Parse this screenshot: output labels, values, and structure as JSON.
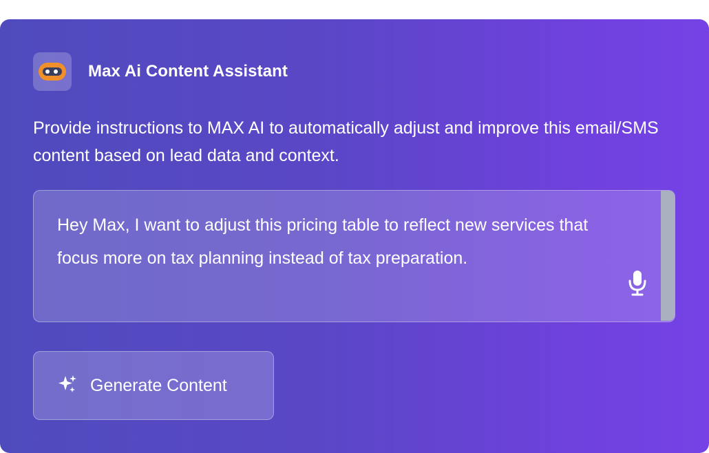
{
  "app": {
    "title": "Max Ai Content Assistant",
    "logo_icon": "robot-face-icon",
    "brand_colors": {
      "gradient_start": "#4f4bbd",
      "gradient_end": "#7642e6",
      "logo_orange": "#f0902a"
    }
  },
  "description": "Provide instructions to MAX AI to automatically adjust and improve this email/SMS content based on lead data and context.",
  "prompt": {
    "value": "Hey Max, I want to adjust this pricing table to reflect new services that focus more on tax planning instead of tax preparation.",
    "mic_icon": "microphone-icon"
  },
  "actions": {
    "generate_label": "Generate Content",
    "generate_icon": "sparkles-icon"
  }
}
